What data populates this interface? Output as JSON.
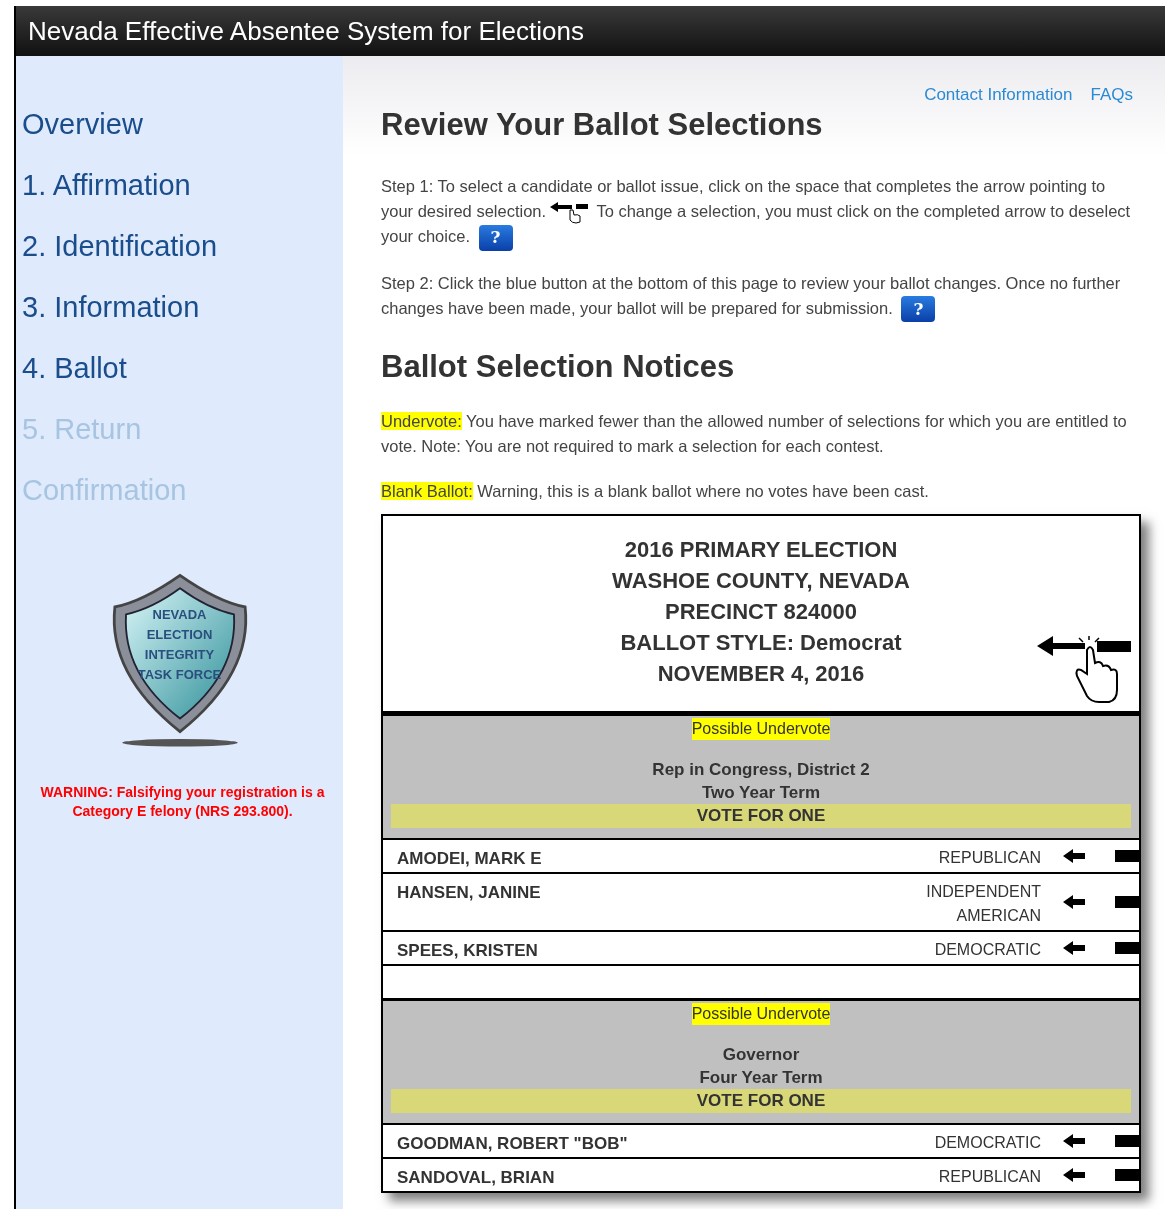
{
  "window": {
    "title": "Nevada Effective Absentee System for Elections"
  },
  "sidebar": {
    "items": [
      {
        "label": "Overview",
        "disabled": false
      },
      {
        "label": "1. Affirmation",
        "disabled": false
      },
      {
        "label": "2. Identification",
        "disabled": false
      },
      {
        "label": "3. Information",
        "disabled": false
      },
      {
        "label": "4. Ballot",
        "disabled": false
      },
      {
        "label": "5. Return",
        "disabled": true
      },
      {
        "label": "Confirmation",
        "disabled": true
      }
    ],
    "logo_lines": [
      "NEVADA",
      "ELECTION",
      "INTEGRITY",
      "TASK FORCE"
    ],
    "warning": "WARNING: Falsifying your registration is a Category E felony (NRS 293.800)."
  },
  "top_links": [
    "Contact Information",
    "FAQs"
  ],
  "heading": "Review Your Ballot Selections",
  "steps": [
    {
      "before": "Step 1:  To select a candidate or ballot issue, click on the space that completes the arrow pointing to your desired selection.",
      "after": " To change a selection, you must click on the completed arrow to deselect your choice.",
      "help": "?"
    },
    {
      "before": "Step 2:  Click the blue button at the bottom of this page to review your ballot changes. Once no further changes have been made, your ballot will be prepared for submission.",
      "help": "?"
    }
  ],
  "notices_heading": "Ballot Selection Notices",
  "notices": [
    {
      "term": "Undervote:",
      "text": "You have marked fewer than the allowed number of selections for which you are entitled to vote. Note: You are not required to mark a selection for each contest."
    },
    {
      "term": "Blank Ballot:",
      "text": "Warning, this is a blank ballot where no votes have been cast."
    }
  ],
  "ballot": {
    "header_lines": [
      "2016 PRIMARY ELECTION",
      "WASHOE COUNTY, NEVADA",
      "PRECINCT 824000",
      "BALLOT STYLE: Democrat",
      "NOVEMBER 4, 2016"
    ],
    "contests": [
      {
        "notice": "Possible Undervote",
        "title_lines": [
          "Rep in Congress, District 2",
          "Two Year Term"
        ],
        "vote_for": "VOTE FOR ONE",
        "candidates": [
          {
            "name": "AMODEI, MARK E",
            "party": "REPUBLICAN",
            "selected": false
          },
          {
            "name": "HANSEN, JANINE",
            "party": "INDEPENDENT AMERICAN",
            "selected": false
          },
          {
            "name": "SPEES, KRISTEN",
            "party": "DEMOCRATIC",
            "selected": false
          }
        ]
      },
      {
        "notice": "Possible Undervote",
        "title_lines": [
          "Governor",
          "Four Year Term"
        ],
        "vote_for": "VOTE FOR ONE",
        "candidates": [
          {
            "name": "GOODMAN, ROBERT \"BOB\"",
            "party": "DEMOCRATIC",
            "selected": false
          },
          {
            "name": "SANDOVAL, BRIAN",
            "party": "REPUBLICAN",
            "selected": false
          }
        ]
      }
    ]
  }
}
